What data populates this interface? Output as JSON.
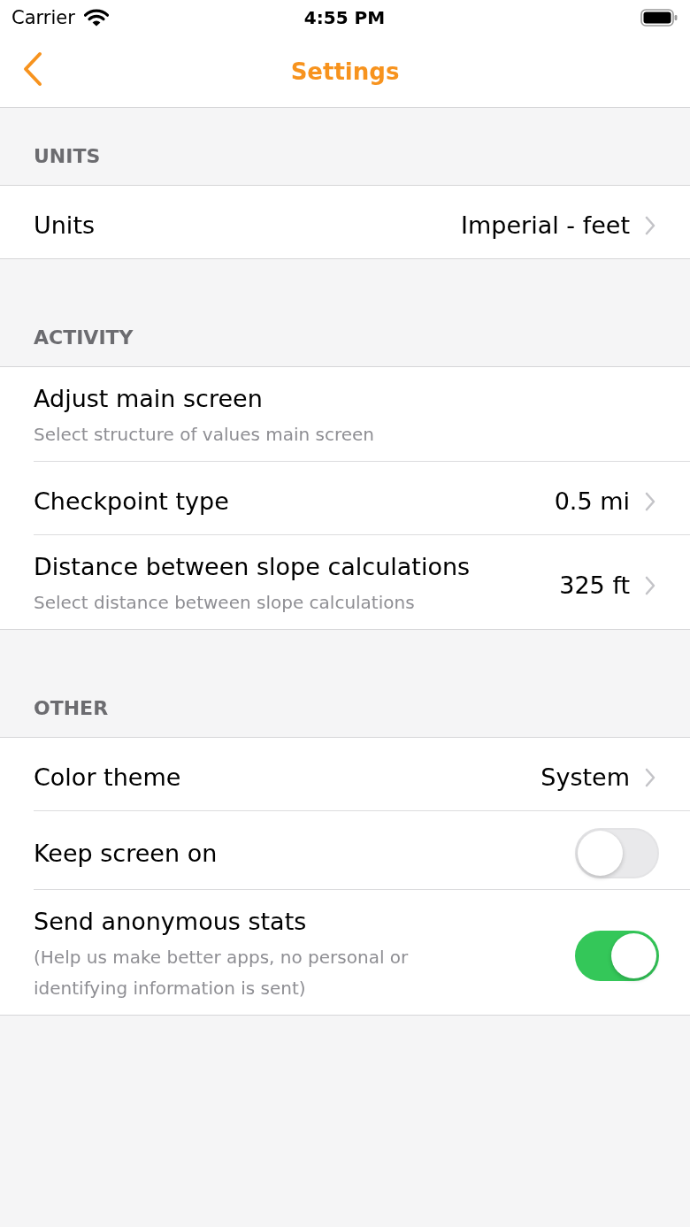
{
  "status_bar": {
    "carrier": "Carrier",
    "time": "4:55 PM"
  },
  "nav_bar": {
    "title": "Settings"
  },
  "sections": [
    {
      "header": "UNITS",
      "rows": [
        {
          "kind": "disclosure",
          "title": "Units",
          "value": "Imperial - feet"
        }
      ]
    },
    {
      "header": "ACTIVITY",
      "rows": [
        {
          "kind": "plain",
          "title": "Adjust main screen",
          "subtitle": "Select structure of values main screen"
        },
        {
          "kind": "disclosure",
          "title": "Checkpoint type",
          "value": "0.5 mi"
        },
        {
          "kind": "disclosure",
          "title": "Distance between slope calculations",
          "subtitle": "Select distance between slope calculations",
          "value": "325 ft"
        }
      ]
    },
    {
      "header": "OTHER",
      "rows": [
        {
          "kind": "disclosure",
          "title": "Color theme",
          "value": "System"
        },
        {
          "kind": "toggle",
          "title": "Keep screen on",
          "on": false
        },
        {
          "kind": "toggle",
          "title": "Send anonymous stats",
          "subtitle": "(Help us make better apps, no personal or identifying information is sent)",
          "on": true
        }
      ]
    }
  ]
}
